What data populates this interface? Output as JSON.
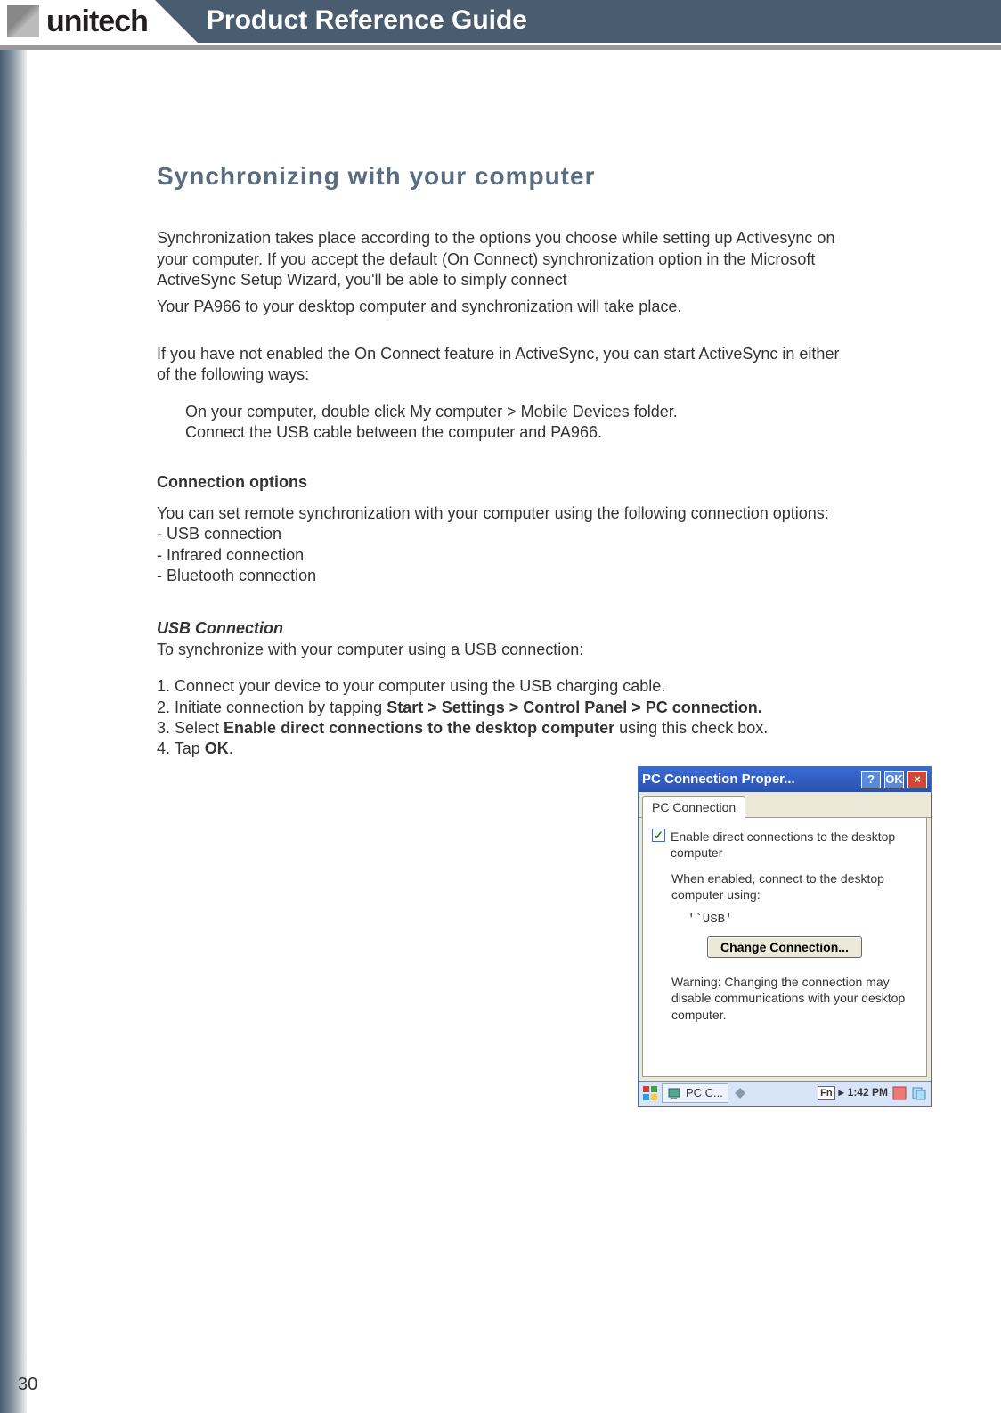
{
  "header": {
    "logo_text": "unitech",
    "title": "Product Reference Guide"
  },
  "section": {
    "title": "Synchronizing with your computer",
    "p1": "Synchronization takes place according to the options you choose while setting up Activesync on your computer. If you accept the default (On Connect) synchronization option in the Microsoft ActiveSync Setup Wizard, you'll be able to simply connect",
    "p1b": "Your PA966 to your desktop computer and synchronization will take place.",
    "p2": "If you have not enabled the On Connect feature in ActiveSync, you can start ActiveSync in either of the following ways:",
    "bullet1": "On your computer, double click My computer > Mobile Devices folder.",
    "bullet2": "Connect the USB cable between the computer and PA966.",
    "subhead1": "Connection options",
    "p3": "You can set remote synchronization with your computer using the following connection options:",
    "opt1": "- USB connection",
    "opt2": "- Infrared connection",
    "opt3": "- Bluetooth connection",
    "usb_head": "USB Connection",
    "usb_intro": "To synchronize with your computer using a USB connection:",
    "step1": "1. Connect your device to your computer using the USB charging cable.",
    "step2a": "2. Initiate connection by tapping ",
    "step2b": "Start > Settings > Control Panel > PC connection.",
    "step3a": "3. Select ",
    "step3b": "Enable direct connections to the desktop computer",
    "step3c": " using this check box.",
    "step4a": "4. Tap ",
    "step4b": "OK",
    "step4c": "."
  },
  "dialog": {
    "title": "PC Connection Proper...",
    "help": "?",
    "ok": "OK",
    "close": "×",
    "tab": "PC Connection",
    "checkbox_mark": "✓",
    "checkbox_label": "Enable direct connections to the desktop computer",
    "desc": "When enabled, connect to the desktop computer using:",
    "usb": "'`USB'",
    "change_btn": "Change Connection...",
    "warning": "Warning: Changing the connection may disable communications with your desktop computer."
  },
  "taskbar": {
    "app": "PC C...",
    "fn": "Fn",
    "time": "1:42 PM"
  },
  "page_number": "30"
}
